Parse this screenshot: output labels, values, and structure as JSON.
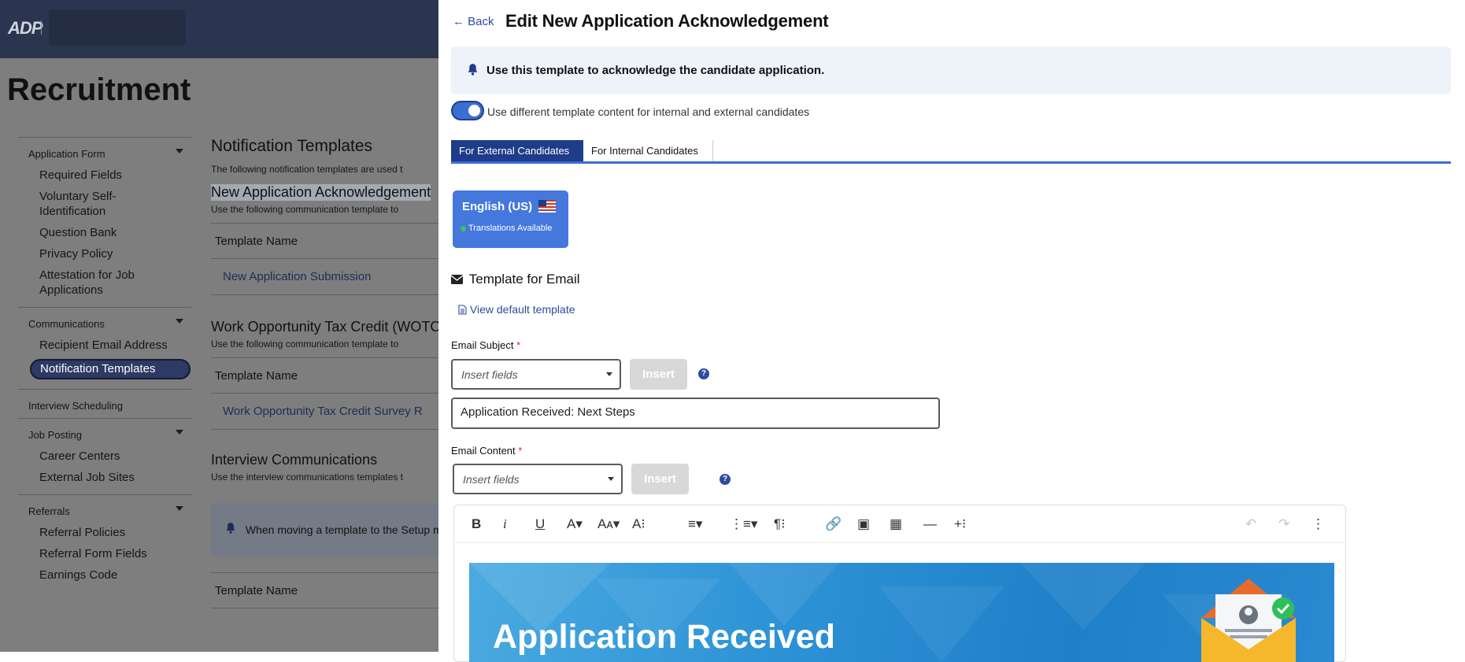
{
  "topbar": {
    "logo": "ADP"
  },
  "page": {
    "title": "Recruitment"
  },
  "sidebar": {
    "groups": [
      {
        "title": "Application Form",
        "items": [
          "Required Fields",
          "Voluntary Self-Identification",
          "Question Bank",
          "Privacy Policy",
          "Attestation for Job Applications"
        ]
      },
      {
        "title": "Communications",
        "items": [
          "Recipient Email Address",
          "Notification Templates"
        ]
      },
      {
        "title": "Interview Scheduling",
        "items": []
      },
      {
        "title": "Job Posting",
        "items": [
          "Career Centers",
          "External Job Sites"
        ]
      },
      {
        "title": "Referrals",
        "items": [
          "Referral Policies",
          "Referral Form Fields",
          "Earnings Code"
        ]
      }
    ]
  },
  "content": {
    "title": "Notification Templates",
    "description": "The following notification templates are used t",
    "section1": {
      "title": "New Application Acknowledgement",
      "desc": "Use the following communication template to",
      "header": "Template Name",
      "row": "New Application Submission"
    },
    "section2": {
      "title": "Work Opportunity Tax Credit (WOTC",
      "desc": "Use the following communication template to",
      "header": "Template Name",
      "row": "Work Opportunity Tax Credit Survey R"
    },
    "section3": {
      "title": "Interview Communications",
      "desc": "Use the interview communications templates t",
      "notice": "When moving a template to the Setup m",
      "header": "Template Name"
    }
  },
  "panel": {
    "back": "Back",
    "title": "Edit New Application Acknowledgement",
    "info": "Use this template to acknowledge the candidate application.",
    "toggle_label": "Use different template content for internal and external candidates",
    "tabs": [
      "For External Candidates",
      "For Internal Candidates"
    ],
    "language": {
      "name": "English (US)",
      "status": "Translations Available"
    },
    "email_header": "Template for Email",
    "view_default": "View default template",
    "subject": {
      "label": "Email Subject",
      "required": "*",
      "placeholder": "Insert fields",
      "insert": "Insert",
      "help": "?",
      "value": "Application Received: Next Steps"
    },
    "content": {
      "label": "Email Content",
      "required": "*",
      "placeholder": "Insert fields",
      "insert": "Insert",
      "help": "?"
    },
    "banner_text": "Application Received"
  },
  "colors": {
    "accent": "#3b6ed1",
    "nav": "#2b3550",
    "active_tab": "#1e3c89",
    "link": "#2b4d9a"
  }
}
